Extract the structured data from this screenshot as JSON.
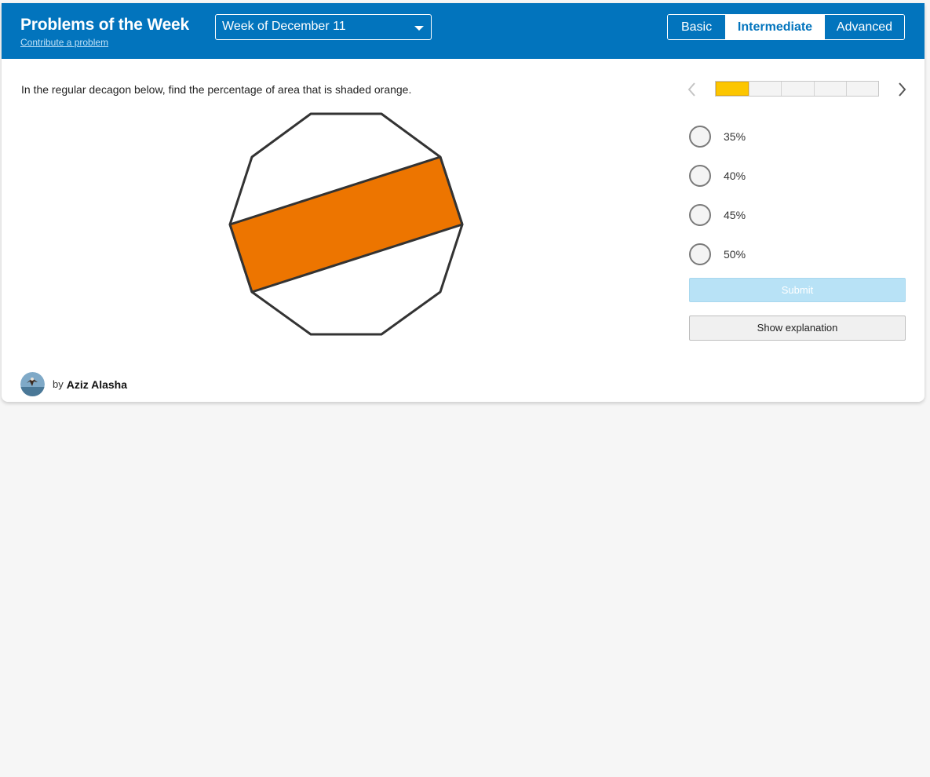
{
  "header": {
    "title": "Problems of the Week",
    "contribute_link": "Contribute a problem",
    "week_selector": "Week of December 11",
    "levels": [
      "Basic",
      "Intermediate",
      "Advanced"
    ],
    "selected_level": "Intermediate",
    "bg_color": "#0274bd"
  },
  "problem": {
    "question": "In the regular decagon below, find the percentage of area that is shaded orange.",
    "figure": {
      "shape": "regular decagon",
      "shaded_color": "#ed7500",
      "outline_color": "#333333"
    }
  },
  "progress": {
    "total_problems": 5,
    "current_problem": 1,
    "fill_color": "#fcc600"
  },
  "answers": {
    "options": [
      "35%",
      "40%",
      "45%",
      "50%"
    ],
    "submit_label": "Submit",
    "explanation_label": "Show explanation"
  },
  "author": {
    "prefix": "by",
    "name": "Aziz Alasha"
  },
  "icons": {
    "prev": "chevron-left-icon",
    "next": "chevron-right-icon",
    "dropdown": "caret-down-icon"
  }
}
